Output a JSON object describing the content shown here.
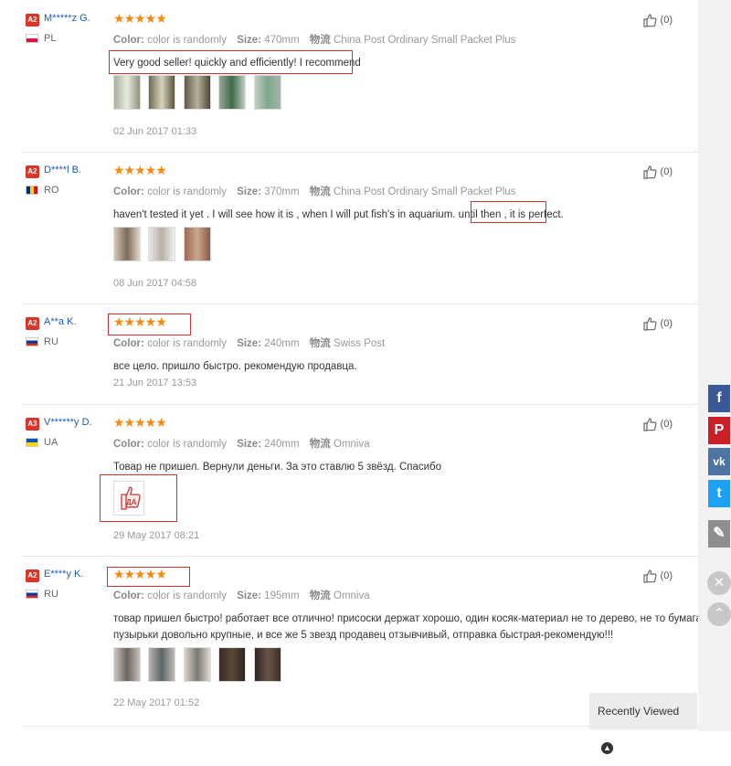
{
  "labels": {
    "color_key": "Color:",
    "size_key": "Size:",
    "shipping_key": "物流"
  },
  "reviews": [
    {
      "badge": "A2",
      "name": "M*****z G.",
      "country": "PL",
      "stars": "★★★★★",
      "color": "color is randomly",
      "size": "470mm",
      "shipping": "China Post Ordinary Small Packet Plus",
      "text": [
        "Very good seller! quickly and efficiently! I recommend"
      ],
      "date": "02 Jun 2017 01:33",
      "likes": "(0)"
    },
    {
      "badge": "A2",
      "name": "D****l B.",
      "country": "RO",
      "stars": "★★★★★",
      "color": "color is randomly",
      "size": "370mm",
      "shipping": "China Post Ordinary Small Packet Plus",
      "text": [
        "haven't tested it yet . I will see how it is , when I will put fish's in aquarium. until then , it is perfect."
      ],
      "date": "08 Jun 2017 04:58",
      "likes": "(0)"
    },
    {
      "badge": "A2",
      "name": "A**a K.",
      "country": "RU",
      "stars": "★★★★★",
      "color": "color is randomly",
      "size": "240mm",
      "shipping": "Swiss Post",
      "text": [
        "все цело. пришло быстро. рекомендую продавца."
      ],
      "date": "21 Jun 2017 13:53",
      "likes": "(0)"
    },
    {
      "badge": "A3",
      "name": "V******y D.",
      "country": "UA",
      "stars": "★★★★★",
      "color": "color is randomly",
      "size": "240mm",
      "shipping": "Omniva",
      "text": [
        "Товар не пришел. Вернули деньги. За это ставлю 5 звёзд. Спасибо"
      ],
      "date": "29 May 2017 08:21",
      "likes": "(0)",
      "thumb_caption": "ДА"
    },
    {
      "badge": "A2",
      "name": "E****y K.",
      "country": "RU",
      "stars": "★★★★★",
      "color": "color is randomly",
      "size": "195mm",
      "shipping": "Omniva",
      "text": [
        "товар пришел быстро! работает все отлично! присоски держат хорошо, один косяк-материал не то дерево, не то бумага!",
        "пузырьки довольно крупные, и все же 5 звезд продавец отзывчивый, отправка быстрая-рекомендую!!!"
      ],
      "date": "22 May 2017 01:52",
      "likes": "(0)"
    }
  ],
  "social": [
    {
      "name": "facebook",
      "glyph": "f",
      "color": "#3b5998"
    },
    {
      "name": "pinterest",
      "glyph": "P",
      "color": "#cb2027"
    },
    {
      "name": "vk",
      "glyph": "vk",
      "color": "#4c75a3"
    },
    {
      "name": "twitter",
      "glyph": "t",
      "color": "#1da1f2"
    },
    {
      "name": "edit",
      "glyph": "✎",
      "color": "#8e8e8e"
    }
  ],
  "close_glyph": "✕",
  "up_glyph": "⌃",
  "recently_viewed": "Recently Viewed",
  "recently_viewed_icon": "chevron-up-icon",
  "theme": {
    "link": "#1a5cb0",
    "star": "#f58a12",
    "highlight": "#d8302c",
    "badge": "#d9362b"
  }
}
